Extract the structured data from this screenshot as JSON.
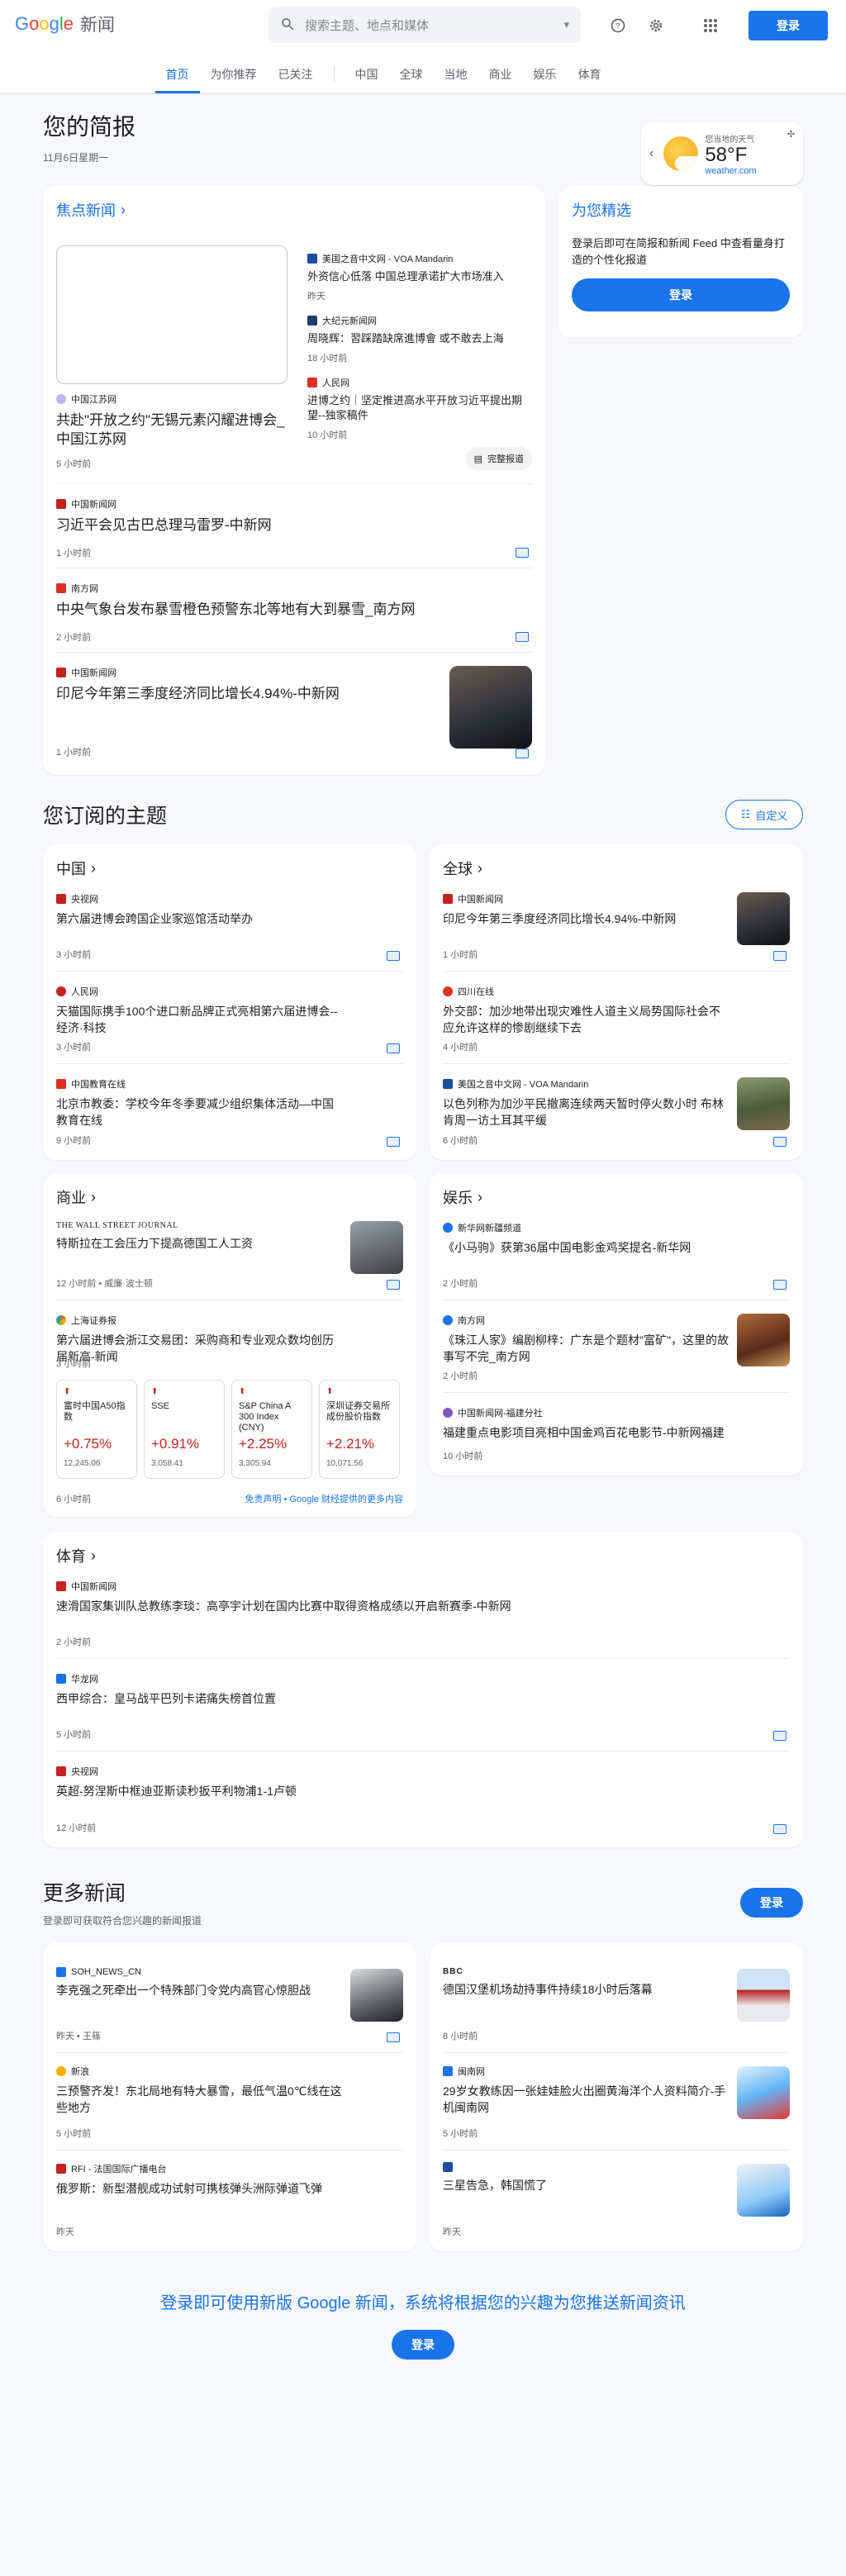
{
  "header": {
    "logo": "Google",
    "logo_suffix": "新闻",
    "search_placeholder": "搜索主题、地点和媒体",
    "signin": "登录"
  },
  "nav": [
    "首页",
    "为你推荐",
    "已关注",
    "中国",
    "全球",
    "当地",
    "商业",
    "娱乐",
    "体育"
  ],
  "brief": {
    "title": "您的简报",
    "date": "11月6日星期一"
  },
  "weather": {
    "label": "您当地的天气",
    "temp": "58°F",
    "source": "weather.com"
  },
  "focus": {
    "title": "焦点新闻",
    "top": {
      "source": "中国江苏网",
      "title": "共赴\"开放之约\"无锡元素闪耀进博会_中国江苏网",
      "meta": "5 小时前"
    },
    "subs": [
      {
        "source": "美国之音中文网 - VOA Mandarin",
        "title": "外资信心低落 中国总理承诺扩大市场准入",
        "meta": "昨天"
      },
      {
        "source": "大纪元新闻网",
        "title": "周晓辉：習踩踏缺席進博會 或不敢去上海",
        "meta": "18 小时前"
      },
      {
        "source": "人民网",
        "title": "进博之约｜坚定推进高水平开放习近平提出期望--独家稿件",
        "meta": "10 小时前"
      }
    ],
    "full_coverage": "完整报道",
    "stories": [
      {
        "source": "中国新闻网",
        "title": "习近平会见古巴总理马雷罗-中新网",
        "meta": "1 小时前"
      },
      {
        "source": "南方网",
        "title": "中央气象台发布暴雪橙色预警东北等地有大到暴雪_南方网",
        "meta": "2 小时前"
      },
      {
        "source": "中国新闻网",
        "title": "印尼今年第三季度经济同比增长4.94%-中新网",
        "meta": "1 小时前"
      }
    ]
  },
  "for_you": {
    "title": "为您精选",
    "text": "登录后即可在简报和新闻 Feed 中查看量身打造的个性化报道",
    "button": "登录"
  },
  "topics": {
    "title": "您订阅的主题",
    "customize": "自定义",
    "china": {
      "title": "中国",
      "stories": [
        {
          "source": "央视网",
          "title": "第六届进博会跨国企业家巡馆活动举办",
          "meta": "3 小时前"
        },
        {
          "source": "人民网",
          "title": "天猫国际携手100个进口新品牌正式亮相第六届进博会--经济·科技",
          "meta": "3 小时前"
        },
        {
          "source": "中国教育在线",
          "title": "北京市教委：学校今年冬季要减少组织集体活动—中国教育在线",
          "meta": "9 小时前"
        }
      ]
    },
    "world": {
      "title": "全球",
      "stories": [
        {
          "source": "中国新闻网",
          "title": "印尼今年第三季度经济同比增长4.94%-中新网",
          "meta": "1 小时前"
        },
        {
          "source": "四川在线",
          "title": "外交部：加沙地带出现灾难性人道主义局势国际社会不应允许这样的惨剧继续下去",
          "meta": "4 小时前"
        },
        {
          "source": "美国之音中文网 - VOA Mandarin",
          "title": "以色列称为加沙平民撤离连续两天暂时停火数小时 布林肯周一访土耳其平缓",
          "meta": "6 小时前"
        }
      ]
    },
    "business": {
      "title": "商业",
      "stories": [
        {
          "source": "THE WALL STREET JOURNAL",
          "title": "特斯拉在工会压力下提高德国工人工资",
          "meta": "12 小时前 • 威廉·波士顿"
        },
        {
          "source": "上海证券报",
          "title": "第六届进博会浙江交易团：采购商和专业观众数均创历届新高-新闻",
          "meta": "3 小时前"
        }
      ],
      "stocks": [
        {
          "name": "富时中国A50指数",
          "pct": "+0.75%",
          "val": "12,245.06"
        },
        {
          "name": "SSE",
          "pct": "+0.91%",
          "val": "3,058.41"
        },
        {
          "name": "S&P China A 300 Index (CNY)",
          "pct": "+2.25%",
          "val": "3,305.94"
        },
        {
          "name": "深圳证券交易所成份股价指数",
          "pct": "+2.21%",
          "val": "10,071.56"
        }
      ],
      "stocks_meta": "6 小时前",
      "stocks_link": "免责声明 • Google 财经提供的更多内容"
    },
    "ent": {
      "title": "娱乐",
      "stories": [
        {
          "source": "新华网新疆频道",
          "title": "《小马驹》获第36届中国电影金鸡奖提名-新华网",
          "meta": "2 小时前"
        },
        {
          "source": "南方网",
          "title": "《珠江人家》编剧柳梓：广东是个题材\"富矿\"，这里的故事写不完_南方网",
          "meta": "2 小时前"
        },
        {
          "source": "中国新闻网-福建分社",
          "title": "福建重点电影项目亮相中国金鸡百花电影节-中新网福建",
          "meta": "10 小时前"
        }
      ]
    },
    "sports": {
      "title": "体育",
      "stories": [
        {
          "source": "中国新闻网",
          "title": "速滑国家集训队总教练李琰：高亭宇计划在国内比赛中取得资格成绩以开启新赛季-中新网",
          "meta": "2 小时前"
        },
        {
          "source": "华龙网",
          "title": "西甲综合：皇马战平巴列卡诺痛失榜首位置",
          "meta": "5 小时前"
        },
        {
          "source": "央视网",
          "title": "英超-努涅斯中框迪亚斯读秒扳平利物浦1-1卢顿",
          "meta": "12 小时前"
        }
      ]
    }
  },
  "more": {
    "title": "更多新闻",
    "sub": "登录即可获取符合您兴趣的新闻报道",
    "button": "登录",
    "left": [
      {
        "source": "SOH_NEWS_CN",
        "title": "李克强之死牵出一个特殊部门令党内高官心惊胆战",
        "meta": "昨天 • 王篠"
      },
      {
        "source": "新浪",
        "title": "三预警齐发！东北局地有特大暴雪，最低气温0℃线在这些地方",
        "meta": "5 小时前"
      },
      {
        "source": "RFI - 法国国际广播电台",
        "title": "俄罗斯：新型潜舰成功试射可携核弹头洲际弹道飞弹",
        "meta": "昨天"
      }
    ],
    "right": [
      {
        "source": "BBC",
        "title": "德国汉堡机场劫持事件持续18小时后落幕",
        "meta": "8 小时前"
      },
      {
        "source": "闽南网",
        "title": "29岁女教练因一张娃娃脸火出圈黄海洋个人资料简介-手机闽南网",
        "meta": "5 小时前"
      },
      {
        "source": "",
        "title": "三星告急，韩国慌了",
        "meta": "昨天"
      }
    ]
  },
  "cta": {
    "text": "登录即可使用新版 Google 新闻，系统将根据您的兴趣为您推送新闻资讯",
    "button": "登录"
  }
}
